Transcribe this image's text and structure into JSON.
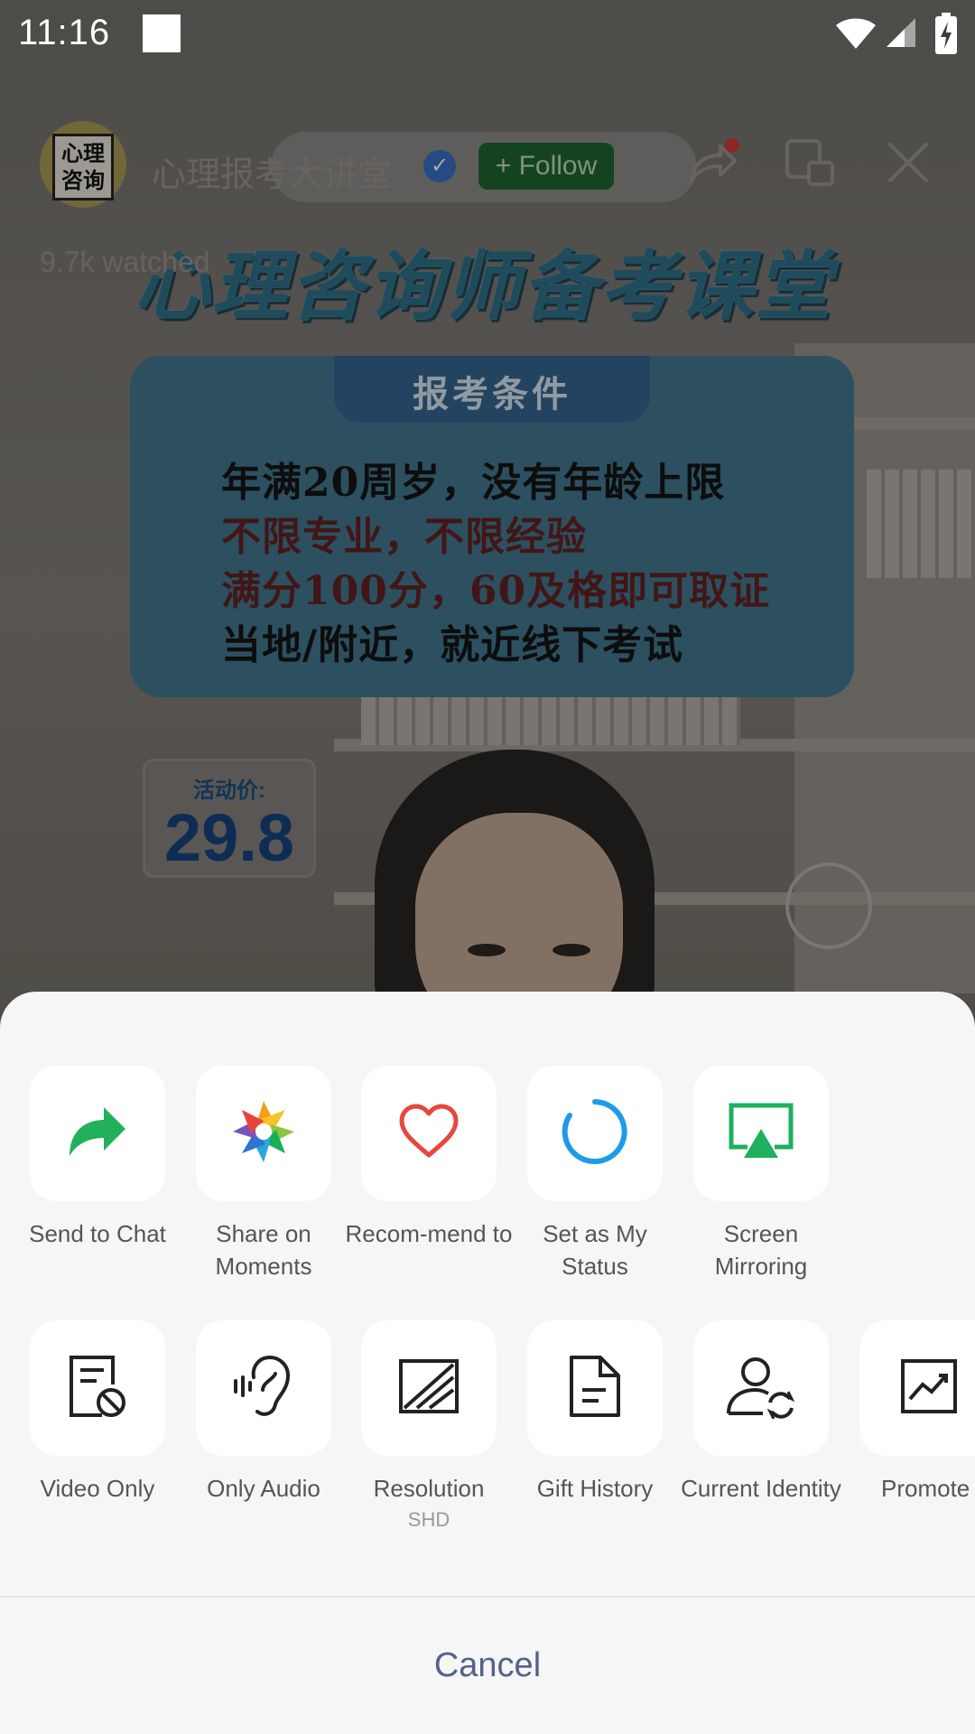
{
  "status_bar": {
    "time": "11:16"
  },
  "video": {
    "channel_name": "心理报考大讲堂",
    "follow_label": "+ Follow",
    "verified_icon": "check-icon",
    "watched": "9.7k watched",
    "avatar_text": "心理咨询",
    "banner_title": "心理咨询师备考课堂",
    "card_title": "报考条件",
    "card_lines": [
      "年满20周岁，没有年龄上限",
      "不限专业，不限经验",
      "满分100分，60及格即可取证",
      "当地/附近，就近线下考试"
    ],
    "price_label": "活动价:",
    "price_value": "29.8"
  },
  "sheet": {
    "row1": [
      {
        "label": "Send to Chat",
        "icon": "send-arrow-icon",
        "color": "#23b05a"
      },
      {
        "label": "Share on Moments",
        "icon": "moments-aperture-icon",
        "color": "#f5a623"
      },
      {
        "label": "Recom-mend to",
        "icon": "heart-icon",
        "color": "#e5483e"
      },
      {
        "label": "Set as My Status",
        "icon": "status-ring-icon",
        "color": "#1e9be8"
      },
      {
        "label": "Screen Mirroring",
        "icon": "screen-mirroring-icon",
        "color": "#1fb05d"
      }
    ],
    "row2": [
      {
        "label": "Video Only",
        "icon": "video-only-icon",
        "sub": ""
      },
      {
        "label": "Only Audio",
        "icon": "ear-icon",
        "sub": ""
      },
      {
        "label": "Resolution",
        "icon": "resolution-icon",
        "sub": "SHD"
      },
      {
        "label": "Gift History",
        "icon": "document-icon",
        "sub": ""
      },
      {
        "label": "Current Identity",
        "icon": "switch-identity-icon",
        "sub": ""
      },
      {
        "label": "Promote",
        "icon": "trend-chart-icon",
        "sub": ""
      }
    ],
    "cancel_label": "Cancel"
  }
}
